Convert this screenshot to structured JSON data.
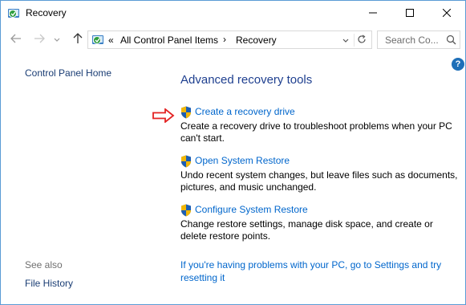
{
  "window": {
    "title": "Recovery",
    "icons": {
      "app": "recovery-icon",
      "minimize": "minimize-icon",
      "maximize": "maximize-icon",
      "close": "close-icon"
    }
  },
  "nav": {
    "icons": {
      "back": "arrow-left-icon",
      "forward": "arrow-right-icon",
      "recent": "chevron-down-icon",
      "up": "arrow-up-icon"
    },
    "address": {
      "chevron": "«",
      "crumbs": [
        "All Control Panel Items",
        "Recovery"
      ],
      "separator": "›"
    },
    "search": {
      "placeholder": "Search Co..."
    }
  },
  "left": {
    "home_link": "Control Panel Home",
    "see_also": "See also",
    "links": [
      "File History"
    ]
  },
  "main": {
    "heading": "Advanced recovery tools",
    "tools": [
      {
        "label": "Create a recovery drive",
        "description": "Create a recovery drive to troubleshoot problems when your PC can't start."
      },
      {
        "label": "Open System Restore",
        "description": "Undo recent system changes, but leave files such as documents, pictures, and music unchanged."
      },
      {
        "label": "Configure System Restore",
        "description": "Change restore settings, manage disk space, and create or delete restore points."
      }
    ],
    "settings_link": "If you're having problems with your PC, go to Settings and try resetting it"
  },
  "help": {
    "label": "?"
  },
  "colors": {
    "link": "#0066cc",
    "heading": "#1e3f8f",
    "left_link": "#1a3d74",
    "arrow": "#e32222",
    "window_border": "#5a9bd5"
  }
}
